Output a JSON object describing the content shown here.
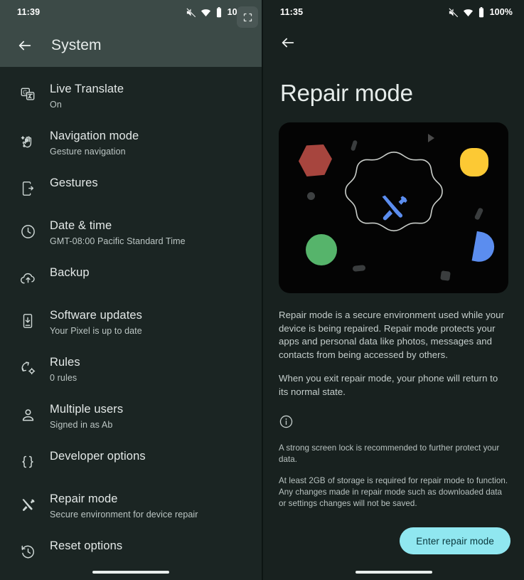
{
  "left": {
    "status": {
      "time": "11:39",
      "battery": "100%",
      "icons": [
        "mute-icon",
        "wifi-icon",
        "battery-icon"
      ],
      "overlay_icon": "fullscreen-icon"
    },
    "appbar": {
      "back_icon": "back-arrow-icon",
      "title": "System"
    },
    "items": [
      {
        "icon": "live-translate-icon",
        "title": "Live Translate",
        "sub": "On"
      },
      {
        "icon": "gesture-hand-icon",
        "title": "Navigation mode",
        "sub": "Gesture navigation"
      },
      {
        "icon": "phone-gesture-icon",
        "title": "Gestures",
        "sub": ""
      },
      {
        "icon": "clock-icon",
        "title": "Date & time",
        "sub": "GMT-08:00 Pacific Standard Time"
      },
      {
        "icon": "cloud-upload-icon",
        "title": "Backup",
        "sub": ""
      },
      {
        "icon": "system-update-icon",
        "title": "Software updates",
        "sub": "Your Pixel is up to date"
      },
      {
        "icon": "rules-gear-icon",
        "title": "Rules",
        "sub": "0 rules"
      },
      {
        "icon": "person-icon",
        "title": "Multiple users",
        "sub": "Signed in as Ab"
      },
      {
        "icon": "braces-icon",
        "title": "Developer options",
        "sub": ""
      },
      {
        "icon": "tools-icon",
        "title": "Repair mode",
        "sub": "Secure environment for device repair"
      },
      {
        "icon": "history-icon",
        "title": "Reset options",
        "sub": ""
      }
    ]
  },
  "right": {
    "status": {
      "time": "11:35",
      "battery": "100%",
      "icons": [
        "mute-icon",
        "wifi-icon",
        "battery-icon"
      ]
    },
    "back_icon": "back-arrow-icon",
    "title": "Repair mode",
    "illustration": {
      "name": "repair-mode-illustration",
      "center_icon": "crossed-tools-icon",
      "colors": {
        "background": "#040404",
        "hexagon": "#a7453e",
        "circle": "#56b46b",
        "squircle": "#fcc934",
        "half_moon": "#5b8def",
        "tools": "#5b8def",
        "blob_outline": "#c9cdc9"
      }
    },
    "paragraphs": [
      "Repair mode is a secure environment used while your device is being repaired. Repair mode protects your apps and personal data like photos, messages and contacts from being accessed by others.",
      "When you exit repair mode, your phone will return to its normal state."
    ],
    "info_icon": "info-circle-icon",
    "fine_print": [
      "A strong screen lock is recommended to further protect your data.",
      "At least 2GB of storage is required for repair mode to function. Any changes made in repair mode such as downloaded data or settings changes will not be saved."
    ],
    "cta_label": "Enter repair mode",
    "cta_color": "#90e7f0"
  }
}
